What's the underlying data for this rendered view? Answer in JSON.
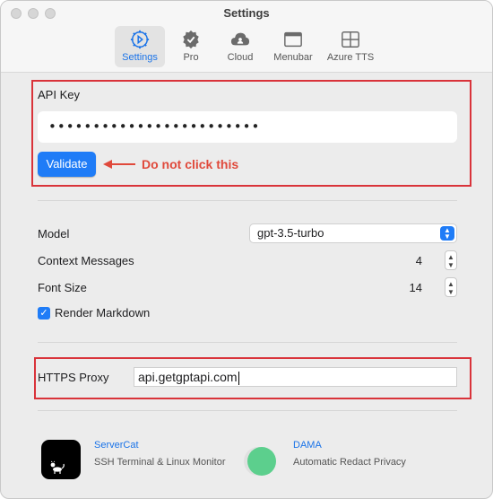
{
  "window": {
    "title": "Settings"
  },
  "tabs": [
    {
      "label": "Settings",
      "icon": "gear-icon",
      "active": true
    },
    {
      "label": "Pro",
      "icon": "verified-badge-icon",
      "active": false
    },
    {
      "label": "Cloud",
      "icon": "cloud-icon",
      "active": false
    },
    {
      "label": "Menubar",
      "icon": "menubar-window-icon",
      "active": false
    },
    {
      "label": "Azure TTS",
      "icon": "grid-icon",
      "active": false
    }
  ],
  "api": {
    "label": "API Key",
    "value": "••••••••••••••••••••••••",
    "validate_label": "Validate",
    "annotation": "Do not click this"
  },
  "model": {
    "label": "Model",
    "value": "gpt-3.5-turbo"
  },
  "context": {
    "label": "Context Messages",
    "value": "4"
  },
  "font_size": {
    "label": "Font Size",
    "value": "14"
  },
  "render_markdown": {
    "label": "Render Markdown",
    "checked": true
  },
  "proxy": {
    "label": "HTTPS Proxy",
    "value": "api.getgptapi.com"
  },
  "promos": [
    {
      "title": "ServerCat",
      "subtitle": "SSH Terminal & Linux Monitor",
      "icon": "cat-app-icon"
    },
    {
      "title": "DAMA",
      "subtitle": "Automatic Redact Privacy",
      "icon": "dama-app-icon"
    }
  ],
  "colors": {
    "accent": "#1f7cf7",
    "annotation_red": "#e0493b",
    "highlight_box": "#d9333a"
  }
}
